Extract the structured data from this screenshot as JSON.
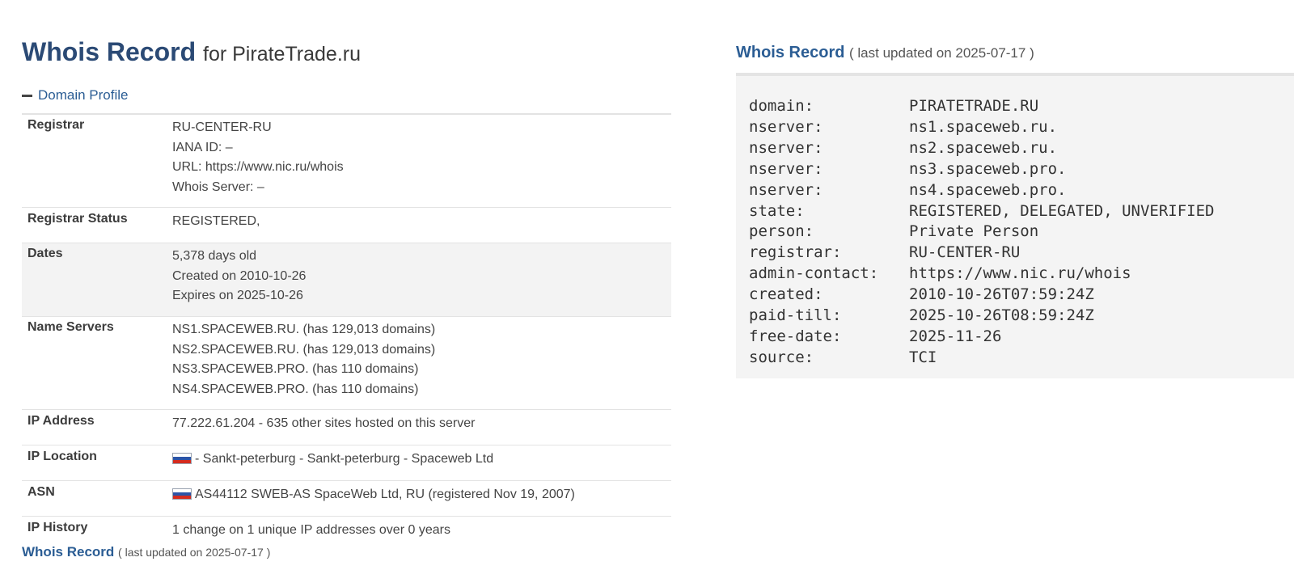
{
  "header": {
    "title": "Whois Record",
    "title_for": "for PirateTrade.ru"
  },
  "domain_profile": {
    "toggle_label": "Domain Profile",
    "registrar": {
      "label": "Registrar",
      "lines": [
        "RU-CENTER-RU",
        "IANA ID: –",
        "URL: https://www.nic.ru/whois",
        "Whois Server: –"
      ]
    },
    "registrar_status": {
      "label": "Registrar Status",
      "value": "REGISTERED,"
    },
    "dates": {
      "label": "Dates",
      "lines": [
        "5,378 days old",
        "Created on 2010-10-26",
        "Expires on 2025-10-26"
      ]
    },
    "name_servers": {
      "label": "Name Servers",
      "lines": [
        "NS1.SPACEWEB.RU. (has 129,013 domains)",
        "NS2.SPACEWEB.RU. (has 129,013 domains)",
        "NS3.SPACEWEB.PRO. (has 110 domains)",
        "NS4.SPACEWEB.PRO. (has 110 domains)"
      ]
    },
    "ip_address": {
      "label": "IP Address",
      "value": "77.222.61.204 - 635 other sites hosted on this server"
    },
    "ip_location": {
      "label": "IP Location",
      "flag": "russia-flag-icon",
      "value": "- Sankt-peterburg - Sankt-peterburg - Spaceweb Ltd"
    },
    "asn": {
      "label": "ASN",
      "flag": "russia-flag-icon",
      "value": "AS44112 SWEB-AS SpaceWeb Ltd, RU (registered Nov 19, 2007)"
    },
    "ip_history": {
      "label": "IP History",
      "value": "1 change on 1 unique IP addresses over 0 years"
    }
  },
  "whois_record_bottom": {
    "title": "Whois Record",
    "subtitle": "( last updated on 2025-07-17 )"
  },
  "whois_record_right": {
    "title": "Whois Record",
    "subtitle": "( last updated on 2025-07-17 )",
    "raw": [
      {
        "key": "domain:",
        "value": "PIRATETRADE.RU"
      },
      {
        "key": "nserver:",
        "value": "ns1.spaceweb.ru."
      },
      {
        "key": "nserver:",
        "value": "ns2.spaceweb.ru."
      },
      {
        "key": "nserver:",
        "value": "ns3.spaceweb.pro."
      },
      {
        "key": "nserver:",
        "value": "ns4.spaceweb.pro."
      },
      {
        "key": "state:",
        "value": "REGISTERED, DELEGATED, UNVERIFIED"
      },
      {
        "key": "person:",
        "value": "Private Person"
      },
      {
        "key": "registrar:",
        "value": "RU-CENTER-RU"
      },
      {
        "key": "admin-contact:",
        "value": "https://www.nic.ru/whois"
      },
      {
        "key": "created:",
        "value": "2010-10-26T07:59:24Z"
      },
      {
        "key": "paid-till:",
        "value": "2025-10-26T08:59:24Z"
      },
      {
        "key": "free-date:",
        "value": "2025-11-26"
      },
      {
        "key": "source:",
        "value": "TCI"
      }
    ]
  },
  "colors": {
    "title_blue": "#2b4a75",
    "link_blue": "#2b5d94",
    "row_shade": "#f3f3f3",
    "raw_background": "#f4f4f4"
  }
}
